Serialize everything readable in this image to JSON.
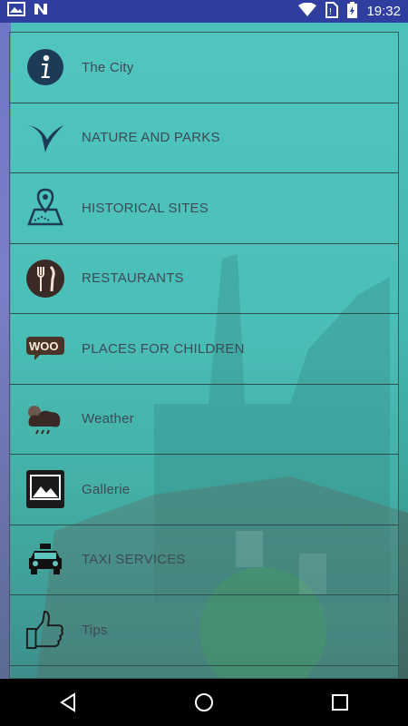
{
  "status": {
    "time": "19:32",
    "icons": [
      "photos-notification-icon",
      "n-app-notification-icon",
      "wifi-icon",
      "no-sim-icon",
      "battery-charging-icon"
    ]
  },
  "menu": {
    "items": [
      {
        "label": "The City",
        "icon": "info-icon"
      },
      {
        "label": "NATURE AND PARKS",
        "icon": "leaf-bird-icon"
      },
      {
        "label": "HISTORICAL SITES",
        "icon": "map-pin-icon"
      },
      {
        "label": "RESTAURANTS",
        "icon": "cutlery-icon"
      },
      {
        "label": "PLACES FOR CHILDREN",
        "icon": "woo-icon"
      },
      {
        "label": "Weather",
        "icon": "storm-cloud-icon"
      },
      {
        "label": "Gallerie",
        "icon": "picture-icon"
      },
      {
        "label": "TAXI SERVICES",
        "icon": "taxi-icon"
      },
      {
        "label": "Tips",
        "icon": "thumbs-up-icon"
      }
    ]
  },
  "navigation": {
    "back": "back-icon",
    "home": "home-icon",
    "recents": "recents-icon"
  }
}
